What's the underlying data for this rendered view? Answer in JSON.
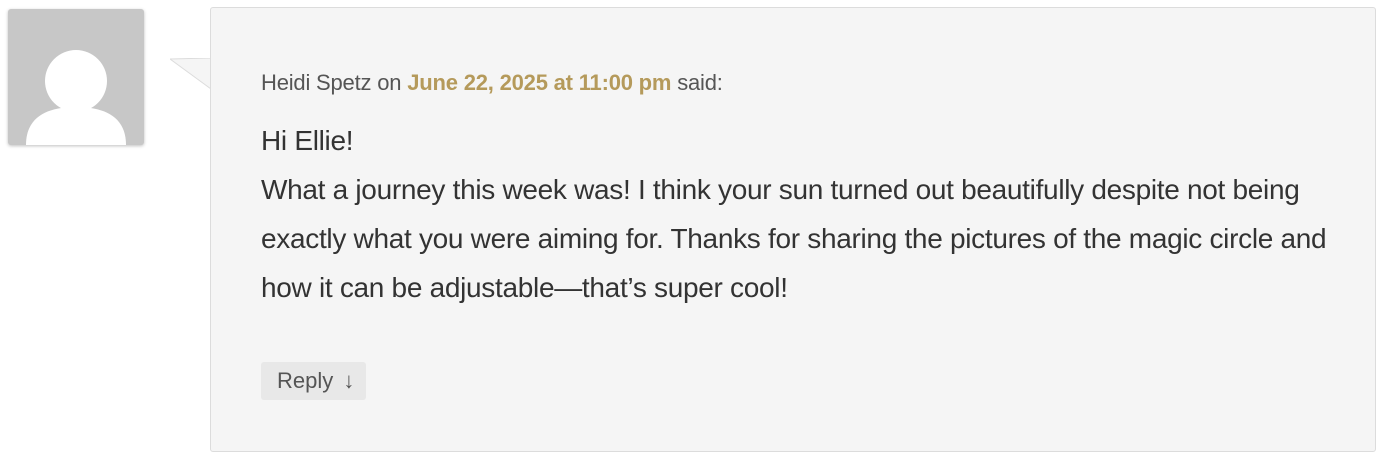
{
  "comment": {
    "author": "Heidi Spetz",
    "on_text": "on",
    "date": "June 22, 2025 at 11:00 pm",
    "said_text": "said:",
    "paragraphs": [
      "Hi Ellie!",
      "What a journey this week was! I think your sun turned out beautifully despite not being exactly what you were aiming for. Thanks for sharing the pictures of the magic circle and how it can be adjustable—that’s super cool!"
    ],
    "reply_label": "Reply",
    "reply_icon": "↓"
  },
  "colors": {
    "date_link": "#b59a5b",
    "bubble_background": "#f5f5f5",
    "avatar_background": "#c7c7c7"
  },
  "icons": {
    "avatar": "default-user-silhouette-icon",
    "reply": "arrow-down-icon"
  }
}
